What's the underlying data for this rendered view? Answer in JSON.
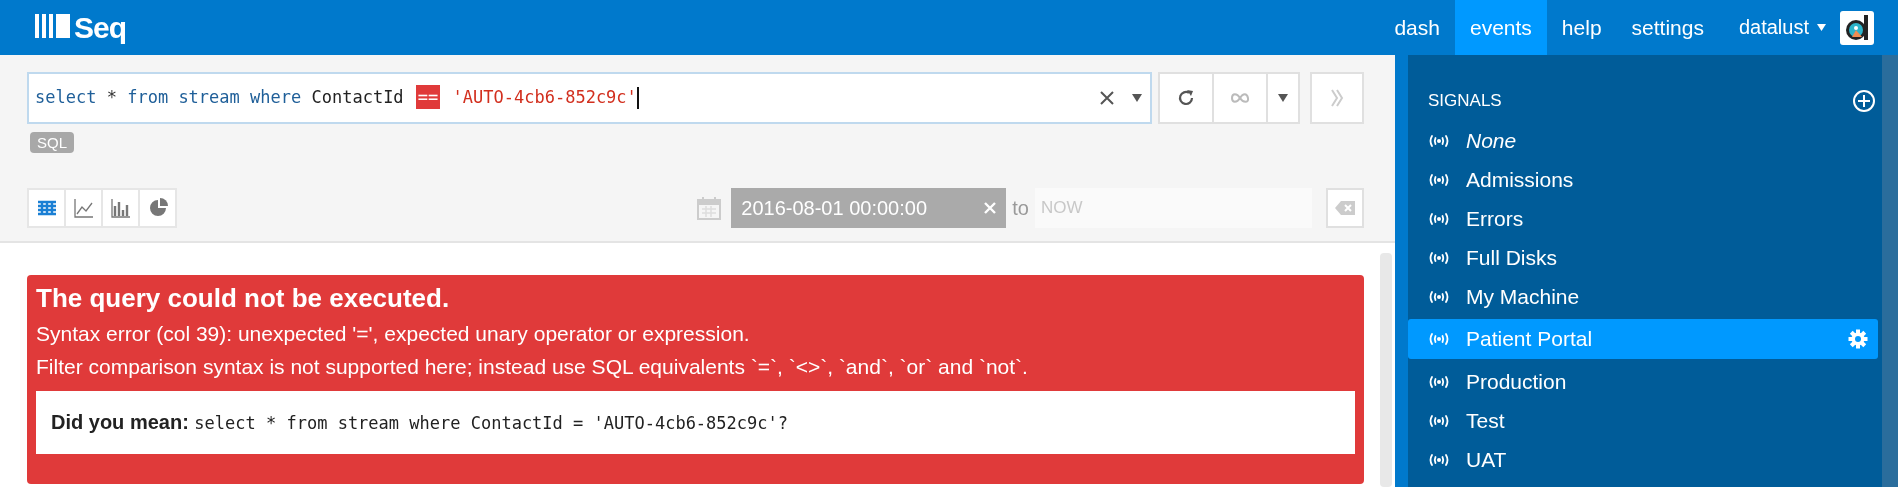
{
  "header": {
    "logo": "Seq",
    "nav": [
      {
        "label": "dash",
        "selected": false
      },
      {
        "label": "events",
        "selected": true
      },
      {
        "label": "help",
        "selected": false
      },
      {
        "label": "settings",
        "selected": false
      }
    ],
    "user": "datalust"
  },
  "query": {
    "tokens": [
      {
        "text": "select",
        "kind": "keyword"
      },
      {
        "text": "*",
        "kind": "operator"
      },
      {
        "text": "from",
        "kind": "keyword"
      },
      {
        "text": "stream",
        "kind": "keyword"
      },
      {
        "text": "where",
        "kind": "keyword"
      },
      {
        "text": "ContactId",
        "kind": "identifier"
      },
      {
        "text": "==",
        "kind": "error"
      },
      {
        "text": "'AUTO-4cb6-852c9c'",
        "kind": "string"
      }
    ],
    "language": "SQL"
  },
  "views": [
    {
      "kind": "table",
      "selected": true
    },
    {
      "kind": "line",
      "selected": false
    },
    {
      "kind": "bar",
      "selected": false
    },
    {
      "kind": "pie",
      "selected": false
    }
  ],
  "range": {
    "from": "2016-08-01 00:00:00",
    "to_label": "to",
    "to_placeholder": "NOW"
  },
  "error": {
    "title": "The query could not be executed.",
    "messages": [
      "Syntax error (col 39): unexpected '=', expected unary operator or expression.",
      "Filter comparison syntax is not supported here; instead use SQL equivalents `=`, `<>`, `and`, `or` and `not`."
    ],
    "suggestion": "**Did you mean:** select * from stream where ContactId = 'AUTO-4cb6-852c9c'?"
  },
  "signals": {
    "heading": "SIGNALS",
    "items": [
      {
        "label": "None",
        "kind": "none",
        "selected": false
      },
      {
        "label": "Admissions",
        "kind": "signal",
        "selected": false
      },
      {
        "label": "Errors",
        "kind": "signal",
        "selected": false
      },
      {
        "label": "Full Disks",
        "kind": "signal",
        "selected": false
      },
      {
        "label": "My Machine",
        "kind": "signal",
        "selected": false
      },
      {
        "label": "Patient Portal",
        "kind": "signal",
        "selected": true
      },
      {
        "label": "Production",
        "kind": "signal",
        "selected": false
      },
      {
        "label": "Test",
        "kind": "signal",
        "selected": false
      },
      {
        "label": "UAT",
        "kind": "signal",
        "selected": false
      }
    ]
  }
}
